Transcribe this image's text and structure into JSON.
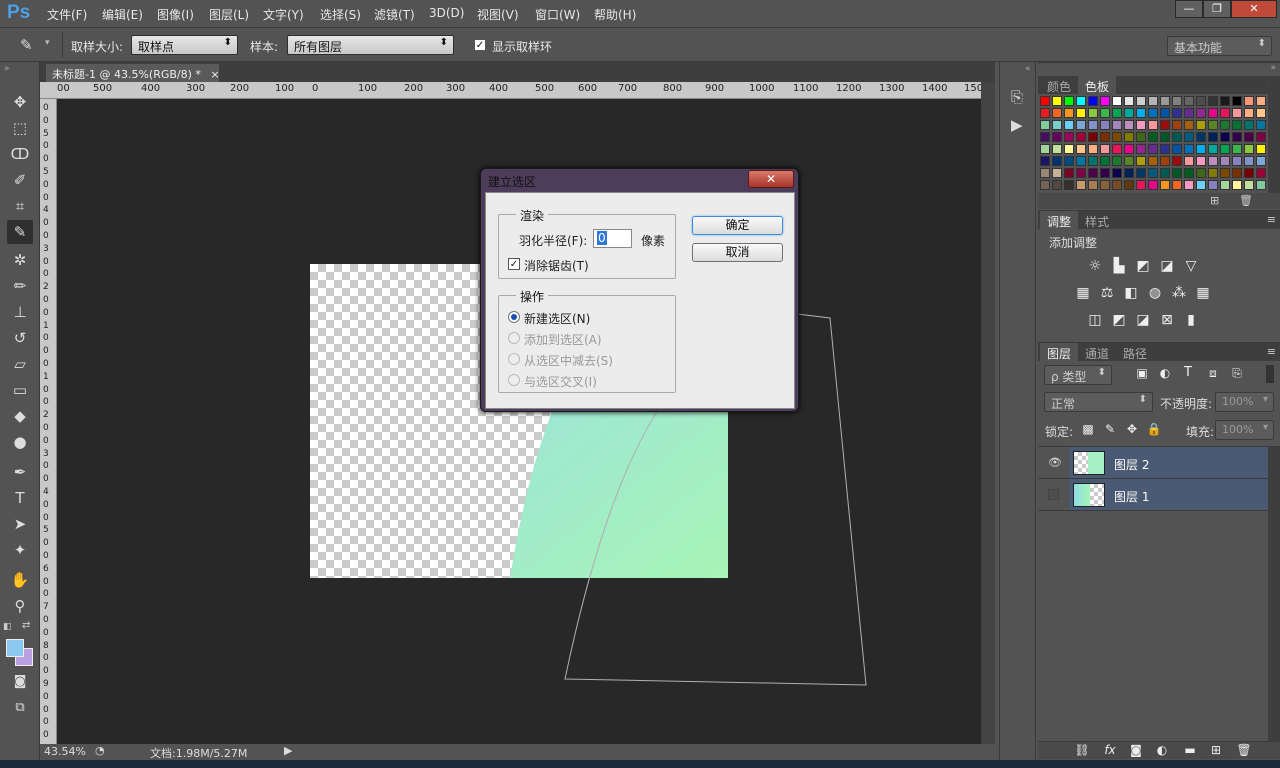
{
  "app": {
    "logo": "Ps"
  },
  "menu": [
    "文件(F)",
    "编辑(E)",
    "图像(I)",
    "图层(L)",
    "文字(Y)",
    "选择(S)",
    "滤镜(T)",
    "3D(D)",
    "视图(V)",
    "窗口(W)",
    "帮助(H)"
  ],
  "window_controls": {
    "minimize": "—",
    "restore": "❐",
    "close": "✕"
  },
  "options": {
    "sample_size_label": "取样大小:",
    "sample_size_value": "取样点",
    "sample_label": "样本:",
    "sample_value": "所有图层",
    "show_ring_label": "显示取样环",
    "show_ring_checked": true,
    "workspace_value": "基本功能"
  },
  "doc_tab": {
    "title": "未标题-1 @ 43.5%(RGB/8) *",
    "close": "×"
  },
  "ruler": {
    "h": [
      "00",
      "500",
      "400",
      "300",
      "200",
      "100",
      "0",
      "100",
      "200",
      "300",
      "400",
      "500",
      "600",
      "700",
      "800",
      "900",
      "1000",
      "1100",
      "1200",
      "1300",
      "1400",
      "150"
    ],
    "v": [
      "0",
      "0",
      "5",
      "0",
      "0",
      "5",
      "0",
      "0",
      "4",
      "0",
      "0",
      "3",
      "0",
      "0",
      "2",
      "0",
      "0",
      "1",
      "0",
      "0",
      "0",
      "1",
      "0",
      "0",
      "2",
      "0",
      "0",
      "3",
      "0",
      "0",
      "4",
      "0",
      "0",
      "5",
      "0",
      "0",
      "6",
      "0",
      "0",
      "7",
      "0",
      "0",
      "8",
      "0",
      "0",
      "9",
      "0",
      "0",
      "0",
      "0"
    ]
  },
  "status": {
    "zoom": "43.54%",
    "doc": "文档:1.98M/5.27M"
  },
  "dialog": {
    "title": "建立选区",
    "close": "✕",
    "render_group": "渲染",
    "feather_label": "羽化半径(F):",
    "feather_value": "0",
    "feather_unit": "像素",
    "antialias_label": "消除锯齿(T)",
    "antialias_checked": true,
    "op_group": "操作",
    "ops": [
      "新建选区(N)",
      "添加到选区(A)",
      "从选区中减去(S)",
      "与选区交叉(I)"
    ],
    "ok": "确定",
    "cancel": "取消"
  },
  "swatches_panel": {
    "tabs": [
      "颜色",
      "色板"
    ]
  },
  "adjust_panel": {
    "tabs": [
      "调整",
      "样式"
    ],
    "title": "添加调整"
  },
  "layers_panel": {
    "tabs": [
      "图层",
      "通道",
      "路径"
    ],
    "filter_label": "ρ 类型",
    "blend": "正常",
    "opacity_label": "不透明度:",
    "opacity": "100%",
    "lock_label": "锁定:",
    "fill_label": "填充:",
    "fill": "100%",
    "layers": [
      {
        "name": "图层 2",
        "visible": true
      },
      {
        "name": "图层 1",
        "visible": false
      }
    ]
  }
}
